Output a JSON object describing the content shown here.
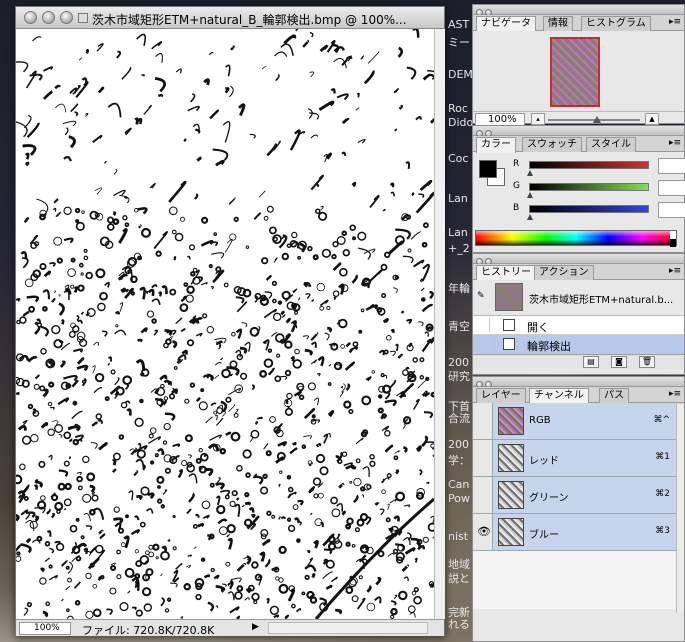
{
  "document": {
    "title": "茨木市域矩形ETM+natural_B_輪郭検出.bmp @ 100%...",
    "zoom": "100%",
    "file_info": "ファイル: 720.8K/720.8K"
  },
  "desktop_items": [
    "AST",
    "ミー",
    "DEM",
    "Roc",
    "Dido",
    "Coc",
    "Lan",
    "Lan",
    "+_2",
    "年輪",
    "青空",
    "200",
    "研究",
    "下首",
    "合流",
    "200",
    "学：",
    "Can",
    "Pow",
    "nist",
    "地域",
    "説と",
    "完新",
    "れる"
  ],
  "navigator": {
    "tabs": [
      "ナビゲータ",
      "情報",
      "ヒストグラム"
    ],
    "zoom": "100%"
  },
  "color": {
    "tabs": [
      "カラー",
      "スウォッチ",
      "スタイル"
    ],
    "channels": [
      {
        "letter": "R",
        "value": "0",
        "gradient": "#cc3333"
      },
      {
        "letter": "G",
        "value": "0",
        "gradient": "#88dd55"
      },
      {
        "letter": "B",
        "value": "0",
        "gradient": "#3344dd"
      }
    ],
    "foreground": "#000000",
    "background": "#ffffff"
  },
  "history": {
    "tabs": [
      "ヒストリー",
      "アクション"
    ],
    "snapshot_label": "茨木市域矩形ETM+natural.b...",
    "states": [
      {
        "label": "開く",
        "active": false
      },
      {
        "label": "輪郭検出",
        "active": true
      }
    ]
  },
  "channels": {
    "tabs": [
      "レイヤー",
      "チャンネル",
      "パス"
    ],
    "items": [
      {
        "label": "RGB",
        "shortcut": "⌘^",
        "visible": false,
        "thumb": "rgb"
      },
      {
        "label": "レッド",
        "shortcut": "⌘1",
        "visible": false,
        "thumb": "gray"
      },
      {
        "label": "グリーン",
        "shortcut": "⌘2",
        "visible": false,
        "thumb": "gray"
      },
      {
        "label": "ブルー",
        "shortcut": "⌘3",
        "visible": true,
        "thumb": "gray"
      }
    ]
  },
  "colors": {
    "selection": "#c6d4ec",
    "history_active": "#b8c8e8"
  }
}
